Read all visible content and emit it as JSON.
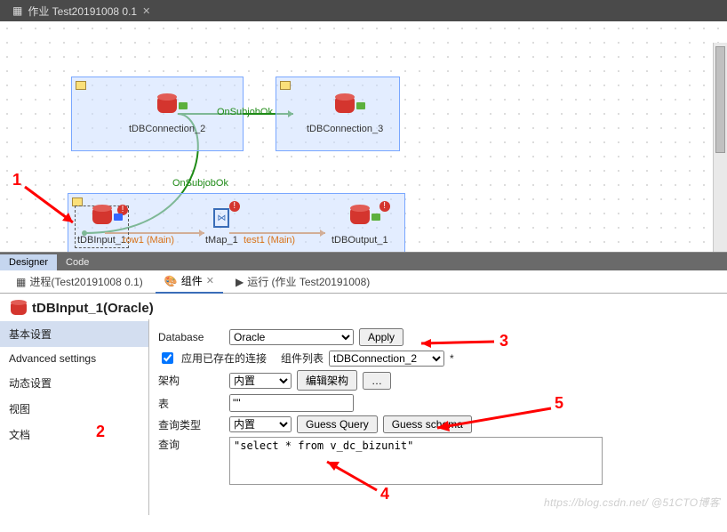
{
  "tab": {
    "title": "作业 Test20191008 0.1"
  },
  "canvas": {
    "components": {
      "conn2": "tDBConnection_2",
      "conn3": "tDBConnection_3",
      "input1": "tDBInput_1",
      "tmap": "tMap_1",
      "output1": "tDBOutput_1"
    },
    "links": {
      "onsubjobok1": "OnSubjobOk",
      "onsubjobok2": "OnSubjobOk",
      "row1": "row1 (Main)",
      "test1": "test1 (Main)"
    },
    "annotations": {
      "a1": "1",
      "a2": "2",
      "a3": "3",
      "a4": "4",
      "a5": "5"
    }
  },
  "dcTabs": {
    "designer": "Designer",
    "code": "Code"
  },
  "lowerTabs": {
    "process": "进程(Test20191008 0.1)",
    "component": "组件",
    "run": "运行 (作业 Test20191008)"
  },
  "componentPanel": {
    "title": "tDBInput_1(Oracle)",
    "nav": {
      "basic": "基本设置",
      "advanced": "Advanced settings",
      "dynamic": "动态设置",
      "view": "视图",
      "doc": "文档"
    },
    "form": {
      "databaseLabel": "Database",
      "databaseValue": "Oracle",
      "applyBtn": "Apply",
      "useExistingConn": "应用已存在的连接",
      "compListLabel": "组件列表",
      "compListValue": "tDBConnection_2",
      "schemaLabel": "架构",
      "schemaValue": "内置",
      "editSchemaBtn": "编辑架构",
      "tableLabel": "表",
      "tableValue": "\"\"",
      "queryTypeLabel": "查询类型",
      "queryTypeValue": "内置",
      "guessQueryBtn": "Guess Query",
      "guessSchemaBtn": "Guess schema",
      "queryLabel": "查询",
      "queryValue": "\"select * from v_dc_bizunit\""
    },
    "watermark": "https://blog.csdn.net/  @51CTO博客"
  }
}
